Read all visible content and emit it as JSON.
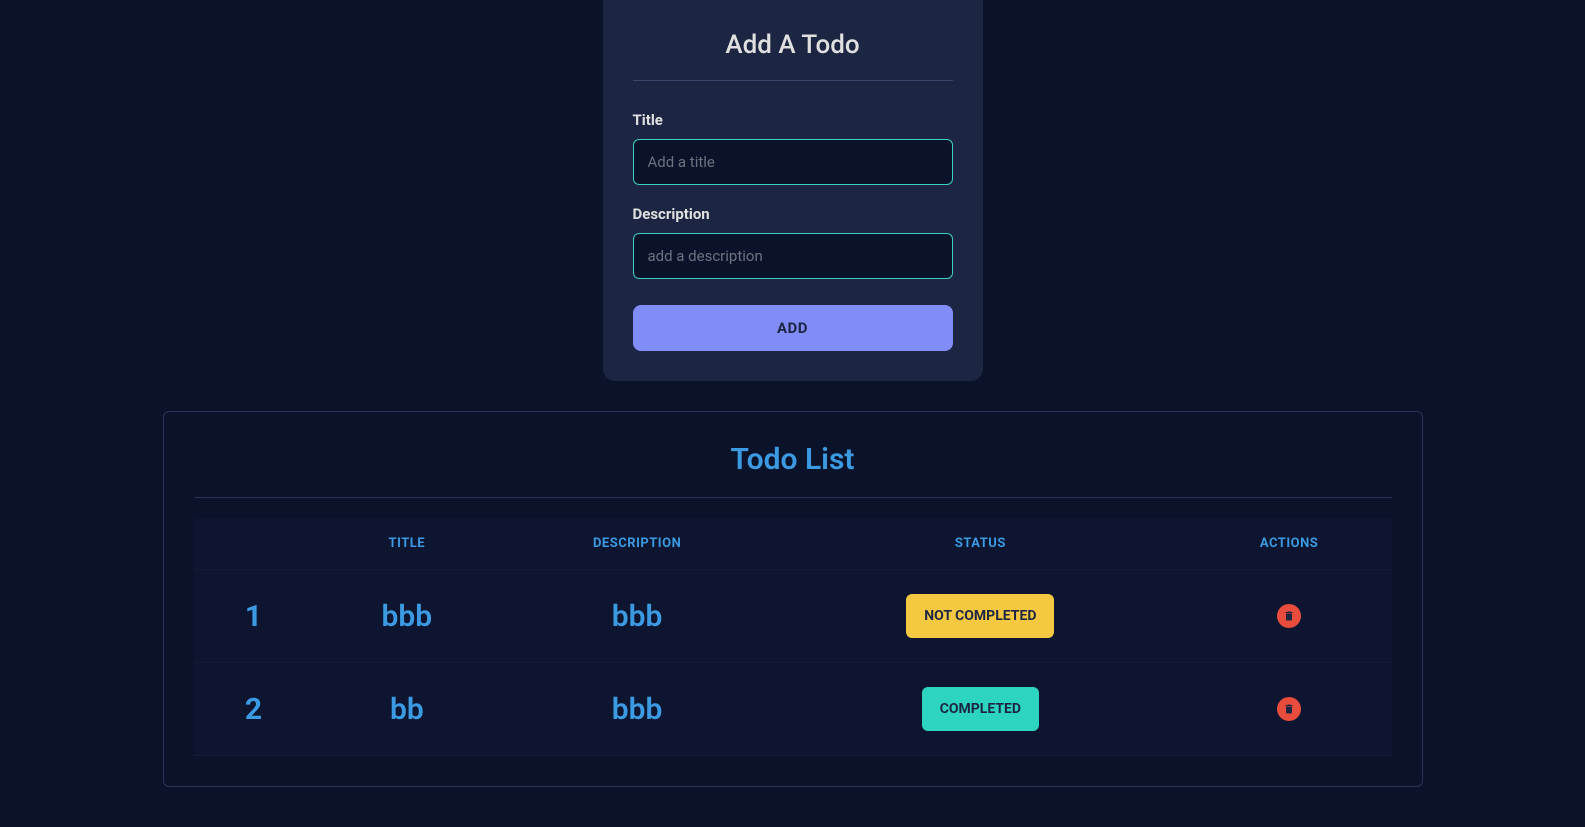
{
  "form": {
    "title": "Add A Todo",
    "title_label": "Title",
    "title_placeholder": "Add a title",
    "description_label": "Description",
    "description_placeholder": "add a description",
    "button_label": "ADD"
  },
  "list": {
    "title": "Todo List",
    "columns": {
      "index": "",
      "title": "TITLE",
      "description": "DESCRIPTION",
      "status": "STATUS",
      "actions": "ACTIONS"
    },
    "status_labels": {
      "not_completed": "NOT COMPLETED",
      "completed": "COMPLETED"
    },
    "rows": [
      {
        "index": "1",
        "title": "bbb",
        "description": "bbb",
        "completed": false
      },
      {
        "index": "2",
        "title": "bb",
        "description": "bbb",
        "completed": true
      }
    ]
  }
}
